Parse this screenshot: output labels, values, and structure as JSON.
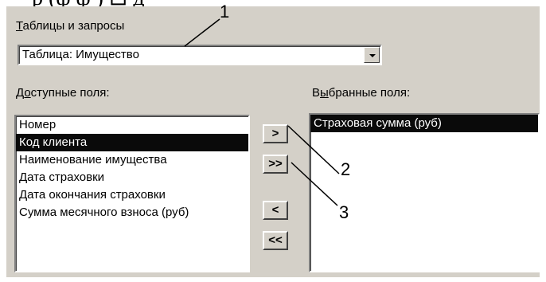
{
  "header_fragment": "р (ф   ф   ) ⊟ д   ",
  "tables_label": "Таблицы и запросы",
  "tables_select": {
    "value": "Таблица: Имущество"
  },
  "available_label": "Доступные поля:",
  "selected_label": "Выбранные поля:",
  "available_fields": [
    {
      "label": "Номер",
      "selected": false
    },
    {
      "label": "Код клиента",
      "selected": true
    },
    {
      "label": "Наименование имущества",
      "selected": false
    },
    {
      "label": "Дата  страховки",
      "selected": false
    },
    {
      "label": "Дата окончания страховки",
      "selected": false
    },
    {
      "label": "Сумма месячного взноса (руб)",
      "selected": false
    }
  ],
  "selected_fields": [
    {
      "label": "Страховая сумма (руб)",
      "selected": true
    }
  ],
  "buttons": {
    "add_one": ">",
    "add_all": ">>",
    "remove_one": "<",
    "remove_all": "<<"
  },
  "callouts": [
    "1",
    "2",
    "3"
  ],
  "colors": {
    "dialog_bg": "#d4d0c8",
    "selection_bg": "#0a0a0a",
    "selection_fg": "#ffffff"
  }
}
